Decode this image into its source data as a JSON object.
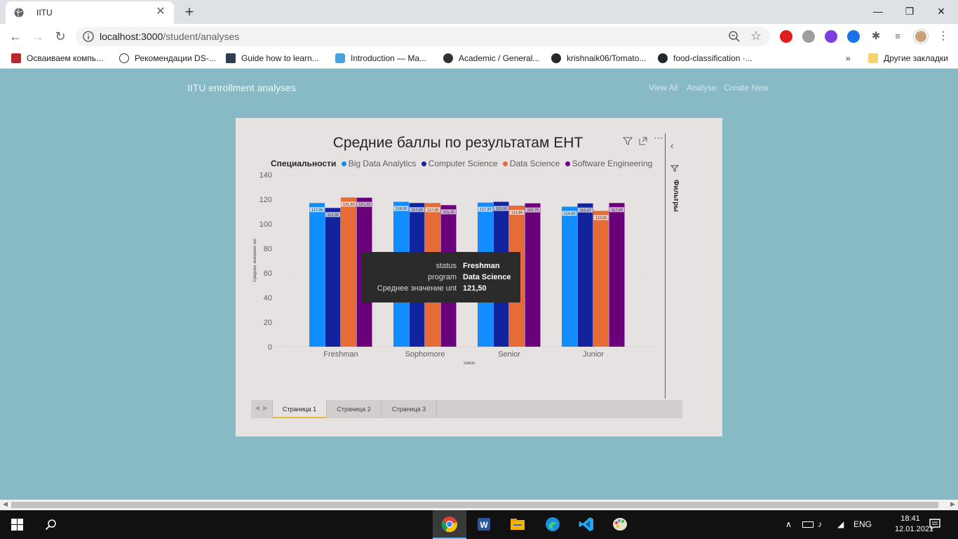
{
  "browser": {
    "tab_title": "IITU",
    "tab_close": "✕",
    "new_tab": "+",
    "url_host": "localhost:3000",
    "url_path": "/student/analyses",
    "bookmarks": [
      "Осваиваем компь...",
      "Рекомендации DS-...",
      "Guide how to learn...",
      "Introduction — Ma...",
      "Academic / General...",
      "krishnaik06/Tomato...",
      "food-classification ·...",
      "»",
      "Другие закладки"
    ]
  },
  "app": {
    "brand": "IITU enrollment analyses",
    "nav": [
      "View All",
      "Analyse",
      "Create New"
    ]
  },
  "report": {
    "title": "Средние баллы по результатам ЕНТ",
    "legend_title": "Специальности",
    "filters_label": "Фильтры",
    "pages": [
      "Страница 1",
      "Страница 2",
      "Страница 3"
    ],
    "active_page": 0,
    "tooltip": [
      {
        "key": "status",
        "value": "Freshman"
      },
      {
        "key": "program",
        "value": "Data Science"
      },
      {
        "key": "Среднее значение unt",
        "value": "121,50"
      }
    ]
  },
  "chart_data": {
    "type": "bar",
    "title": "Средние баллы по результатам ЕНТ",
    "xlabel": "status",
    "ylabel": "Среднее значение unt",
    "categories": [
      "Freshman",
      "Sophomore",
      "Senior",
      "Junior"
    ],
    "ylim": [
      0,
      140
    ],
    "yticks": [
      0,
      20,
      40,
      60,
      80,
      100,
      120,
      140
    ],
    "legend_position": "top",
    "series": [
      {
        "name": "Big Data Analytics",
        "color": "#118dff",
        "values": [
          117.0,
          118.0,
          117.33,
          114.0
        ],
        "labels": [
          "117,00",
          "118,00",
          "117,33",
          "114,00"
        ]
      },
      {
        "name": "Computer Science",
        "color": "#12239e",
        "values": [
          113.0,
          117.0,
          118.0,
          116.67
        ],
        "labels": [
          "113,00",
          "117,00",
          "118,00",
          "116,67"
        ]
      },
      {
        "name": "Data Science",
        "color": "#e66c37",
        "values": [
          121.5,
          117.0,
          114.86,
          110.6
        ],
        "labels": [
          "121,50",
          "117,00",
          "114,86",
          "110,60"
        ]
      },
      {
        "name": "Software Engineering",
        "color": "#6b007b",
        "values": [
          121.33,
          115.25,
          116.75,
          117.0
        ],
        "labels": [
          "121,33",
          "115,25",
          "116,75",
          "117,00"
        ]
      }
    ]
  },
  "taskbar": {
    "lang": "ENG",
    "time": "18:41",
    "date": "12.01.2021"
  }
}
